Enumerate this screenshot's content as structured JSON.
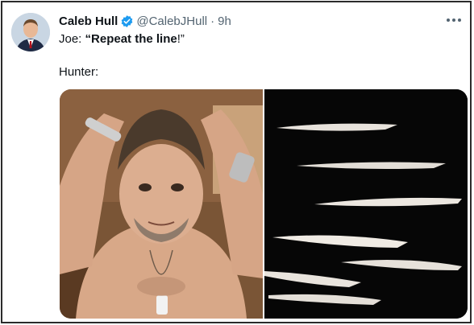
{
  "tweet": {
    "display_name": "Caleb Hull",
    "handle": "@CalebJHull",
    "separator": "·",
    "time": "9h",
    "text_prefix": "Joe: ",
    "text_quote": "“Repeat the line",
    "text_suffix": "!”",
    "line2": "Hunter:",
    "verified_icon": "verified-badge-icon",
    "more_icon": "more-options-icon",
    "accent_color": "#1d9bf0"
  }
}
